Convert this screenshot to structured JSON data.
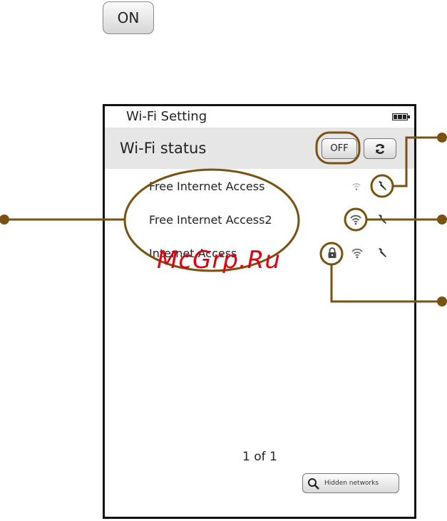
{
  "on_button": {
    "label": "ON"
  },
  "screen": {
    "title": "Wi-Fi Setting",
    "status_label": "Wi-Fi status",
    "off_button": "OFF",
    "networks": [
      {
        "name": "Free Internet Access",
        "locked": false
      },
      {
        "name": "Free Internet Access2",
        "locked": false
      },
      {
        "name": "Internet Access",
        "locked": true
      }
    ],
    "pager": "1 of 1",
    "hidden_networks_button": "Hidden networks"
  },
  "watermark": "McGrp.Ru",
  "colors": {
    "callout": "#7a5210",
    "status_bar": "#e6e6e6",
    "watermark": "#e0000f"
  }
}
